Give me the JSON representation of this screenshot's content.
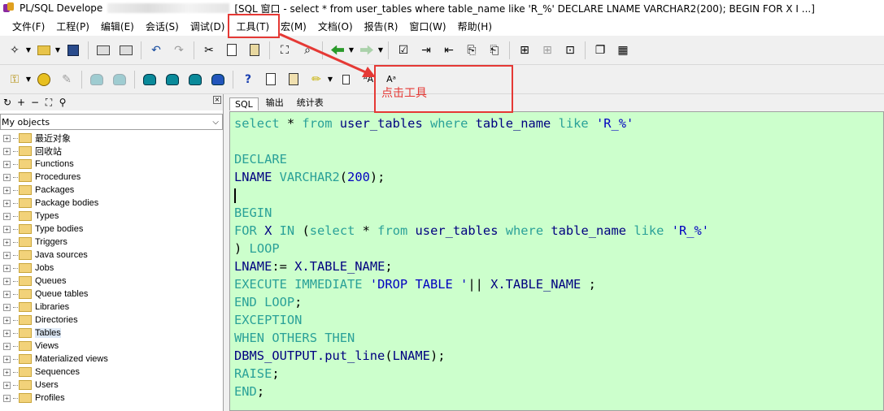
{
  "window": {
    "app_title": "PL/SQL Develope",
    "title_rest": "[SQL 窗口 - select * from user_tables where table_name like 'R_%' DECLARE LNAME VARCHAR2(200); BEGIN FOR X I ...]"
  },
  "menu": [
    {
      "label": "文件(F)"
    },
    {
      "label": "工程(P)"
    },
    {
      "label": "编辑(E)"
    },
    {
      "label": "会话(S)"
    },
    {
      "label": "调试(D)"
    },
    {
      "label": "工具(T)"
    },
    {
      "label": "宏(M)"
    },
    {
      "label": "文档(O)"
    },
    {
      "label": "报告(R)"
    },
    {
      "label": "窗口(W)"
    },
    {
      "label": "帮助(H)"
    }
  ],
  "object_browser": {
    "filter": "My objects",
    "nodes": [
      {
        "label": "最近对象"
      },
      {
        "label": "回收站"
      },
      {
        "label": "Functions"
      },
      {
        "label": "Procedures"
      },
      {
        "label": "Packages"
      },
      {
        "label": "Package bodies"
      },
      {
        "label": "Types"
      },
      {
        "label": "Type bodies"
      },
      {
        "label": "Triggers"
      },
      {
        "label": "Java sources"
      },
      {
        "label": "Jobs"
      },
      {
        "label": "Queues"
      },
      {
        "label": "Queue tables"
      },
      {
        "label": "Libraries"
      },
      {
        "label": "Directories"
      },
      {
        "label": "Tables",
        "selected": true
      },
      {
        "label": "Views"
      },
      {
        "label": "Materialized views"
      },
      {
        "label": "Sequences"
      },
      {
        "label": "Users"
      },
      {
        "label": "Profiles"
      }
    ]
  },
  "editor": {
    "tabs": [
      {
        "label": "SQL",
        "active": true
      },
      {
        "label": "输出"
      },
      {
        "label": "统计表"
      }
    ],
    "background": "#ccffcc",
    "lines": [
      [
        [
          "kw",
          "select"
        ],
        [
          "op",
          " * "
        ],
        [
          "kw",
          "from"
        ],
        [
          "op",
          " "
        ],
        [
          "id",
          "user_tables"
        ],
        [
          "op",
          " "
        ],
        [
          "kw",
          "where"
        ],
        [
          "op",
          " "
        ],
        [
          "id",
          "table_name"
        ],
        [
          "op",
          " "
        ],
        [
          "kw",
          "like"
        ],
        [
          "op",
          " "
        ],
        [
          "str",
          "'R_%'"
        ]
      ],
      [],
      [
        [
          "kw",
          "DECLARE"
        ]
      ],
      [
        [
          "id",
          "LNAME"
        ],
        [
          "op",
          " "
        ],
        [
          "kw",
          "VARCHAR2"
        ],
        [
          "op",
          "("
        ],
        [
          "str",
          "200"
        ],
        [
          "op",
          ");"
        ]
      ],
      "caret",
      [
        [
          "kw",
          "BEGIN"
        ]
      ],
      [
        [
          "kw",
          "FOR"
        ],
        [
          "op",
          " "
        ],
        [
          "id",
          "X"
        ],
        [
          "op",
          " "
        ],
        [
          "kw",
          "IN"
        ],
        [
          "op",
          " ("
        ],
        [
          "kw",
          "select"
        ],
        [
          "op",
          " * "
        ],
        [
          "kw",
          "from"
        ],
        [
          "op",
          " "
        ],
        [
          "id",
          "user_tables"
        ],
        [
          "op",
          " "
        ],
        [
          "kw",
          "where"
        ],
        [
          "op",
          " "
        ],
        [
          "id",
          "table_name"
        ],
        [
          "op",
          " "
        ],
        [
          "kw",
          "like"
        ],
        [
          "op",
          " "
        ],
        [
          "str",
          "'R_%'"
        ]
      ],
      [
        [
          "op",
          ") "
        ],
        [
          "kw",
          "LOOP"
        ]
      ],
      [
        [
          "id",
          "LNAME"
        ],
        [
          "op",
          ":= "
        ],
        [
          "id",
          "X.TABLE_NAME"
        ],
        [
          "op",
          ";"
        ]
      ],
      [
        [
          "kw",
          "EXECUTE"
        ],
        [
          "op",
          " "
        ],
        [
          "kw",
          "IMMEDIATE"
        ],
        [
          "op",
          " "
        ],
        [
          "str",
          "'DROP TABLE '"
        ],
        [
          "op",
          "|| "
        ],
        [
          "id",
          "X.TABLE_NAME"
        ],
        [
          "op",
          " ;"
        ]
      ],
      [
        [
          "kw",
          "END"
        ],
        [
          "op",
          " "
        ],
        [
          "kw",
          "LOOP"
        ],
        [
          "op",
          ";"
        ]
      ],
      [
        [
          "kw",
          "EXCEPTION"
        ]
      ],
      [
        [
          "kw",
          "WHEN"
        ],
        [
          "op",
          " "
        ],
        [
          "kw",
          "OTHERS"
        ],
        [
          "op",
          " "
        ],
        [
          "kw",
          "THEN"
        ]
      ],
      [
        [
          "id",
          "DBMS_OUTPUT.put_line"
        ],
        [
          "op",
          "("
        ],
        [
          "id",
          "LNAME"
        ],
        [
          "op",
          ");"
        ]
      ],
      [
        [
          "kw",
          "RAISE"
        ],
        [
          "op",
          ";"
        ]
      ],
      [
        [
          "kw",
          "END"
        ],
        [
          "op",
          ";"
        ]
      ]
    ]
  },
  "annotation": {
    "text": "点击工具",
    "color": "#e53935"
  }
}
